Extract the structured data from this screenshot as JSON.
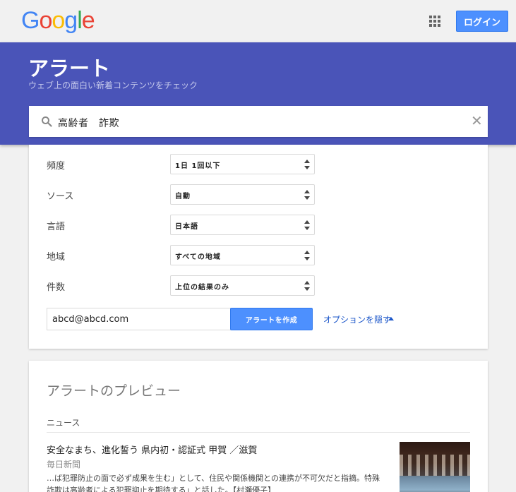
{
  "header": {
    "logo_letters": [
      {
        "char": "G",
        "color": "#4285f4"
      },
      {
        "char": "o",
        "color": "#ea4335"
      },
      {
        "char": "o",
        "color": "#fbbc05"
      },
      {
        "char": "g",
        "color": "#4285f4"
      },
      {
        "char": "l",
        "color": "#34a853"
      },
      {
        "char": "e",
        "color": "#ea4335"
      }
    ],
    "apps_icon": "apps-grid-icon",
    "login_label": "ログイン"
  },
  "hero": {
    "title": "アラート",
    "subtitle": "ウェブ上の面白い新着コンテンツをチェック",
    "search_value": "高齢者　詐欺",
    "search_icon": "search-icon",
    "clear_icon": "close-icon"
  },
  "options": {
    "rows": [
      {
        "label": "頻度",
        "value": "1日 1回以下"
      },
      {
        "label": "ソース",
        "value": "自動"
      },
      {
        "label": "言語",
        "value": "日本語"
      },
      {
        "label": "地域",
        "value": "すべての地域"
      },
      {
        "label": "件数",
        "value": "上位の結果のみ"
      }
    ],
    "email_value": "abcd@abcd.com",
    "create_label": "アラートを作成",
    "hide_options_label": "オプションを隠す"
  },
  "preview": {
    "title": "アラートのプレビュー",
    "section": "ニュース",
    "item": {
      "headline": "安全なまち、進化誓う 県内初・認証式 甲賀 ／滋賀",
      "source": "毎日新聞",
      "snippet": "…ば犯罪防止の面で必ず成果を生む」として、住民や関係機関との連携が不可欠だと指摘。特殊詐欺は高齢者による犯罪抑止を期待する」と話した。【村瀬優子】"
    }
  },
  "colors": {
    "accent": "#4a54b8",
    "button": "#4d90fe",
    "link": "#1a55c9"
  }
}
